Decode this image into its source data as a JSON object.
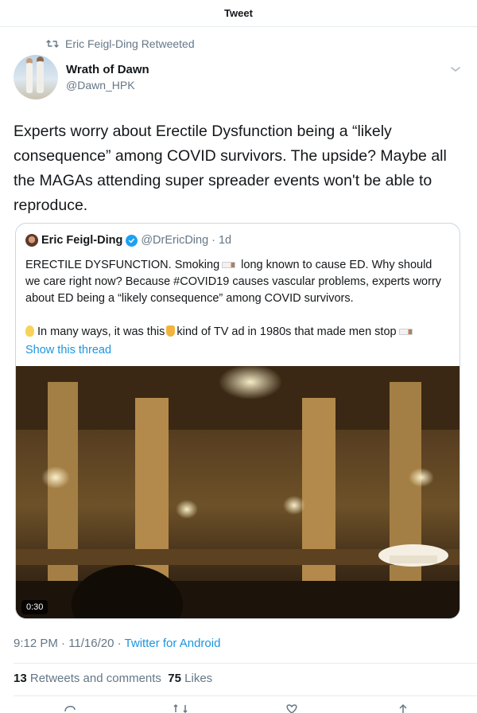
{
  "header": {
    "title": "Tweet"
  },
  "retweet": {
    "text": "Eric Feigl-Ding Retweeted"
  },
  "author": {
    "name": "Wrath of Dawn",
    "handle": "@Dawn_HPK"
  },
  "tweet": {
    "text": "Experts worry about Erectile Dysfunction being a “likely consequence” among COVID survivors. The upside? Maybe all the MAGAs attending super spreader events won't be able to reproduce."
  },
  "quote": {
    "name": "Eric Feigl-Ding",
    "handle": "@DrEricDing",
    "time": "· 1d",
    "line1_a": "ERECTILE DYSFUNCTION. Smoking",
    "line1_b": "long known to cause ED. Why should we care right now? Because #COVID19 causes vascular problems, experts worry about ED being a “likely consequence” among COVID survivors.",
    "line2_a": "In many ways, it was this",
    "line2_b": "kind of TV ad in 1980s that made men stop",
    "show_thread": "Show this thread",
    "video_duration": "0:30"
  },
  "meta": {
    "time": "9:12 PM · 11/16/20 · ",
    "source": "Twitter for Android"
  },
  "stats": {
    "retweets_count": "13",
    "retweets_label": "Retweets and comments",
    "likes_count": "75",
    "likes_label": "Likes"
  },
  "icons": [
    "retweet-icon",
    "chevron-down-icon",
    "verified-badge-icon",
    "reply-icon",
    "like-icon",
    "share-icon"
  ],
  "colors": {
    "accent": "#1b95e0",
    "muted": "#657786",
    "text": "#14171a",
    "border": "#ccd6dd"
  }
}
